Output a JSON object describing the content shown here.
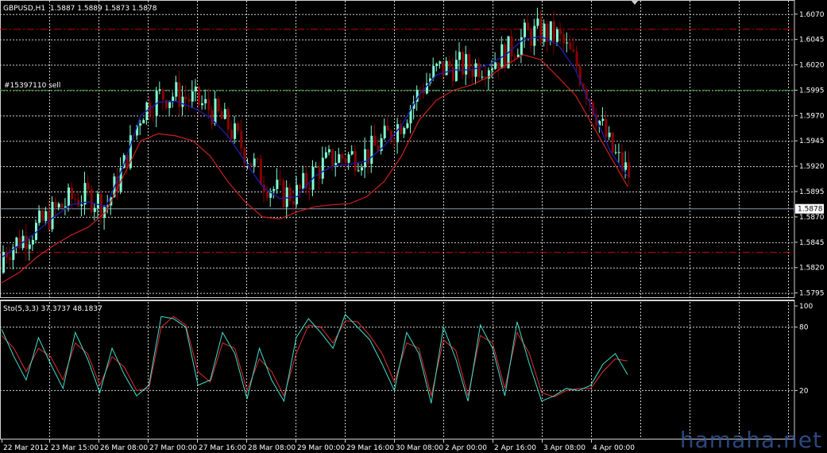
{
  "header": {
    "symbol": "GBPUSD,H1",
    "quote": "1.5887 1.5889 1.5873 1.5878"
  },
  "order_label": "#15397110 sell",
  "indicator_header": "Sto(5,3,3) 37.3737 48.1837",
  "watermark": "hamaha.net",
  "colors": {
    "background": "#000000",
    "bull": "#7fffd4",
    "bear": "#8b0000",
    "ma_fast": "#cc1f1f",
    "ma_slow": "#1c1ca0",
    "stoch_main": "#40e0d0",
    "stoch_signal": "#e03030",
    "level_red": "#cc0000",
    "level_green": "#339933",
    "bid_line": "#8899aa",
    "grid": "#cfcfcf"
  },
  "chart_data": [
    {
      "type": "candlestick",
      "name": "price",
      "ylim": [
        1.579,
        1.608
      ],
      "y_ticks": [
        "1.6070",
        "1.6045",
        "1.6020",
        "1.5995",
        "1.5970",
        "1.5945",
        "1.5920",
        "1.5895",
        "1.5870",
        "1.5845",
        "1.5820",
        "1.5795"
      ],
      "x_ticks": [
        "22 Mar 2012",
        "23 Mar 15:00",
        "26 Mar 08:00",
        "27 Mar 00:00",
        "27 Mar 16:00",
        "28 Mar 08:00",
        "29 Mar 00:00",
        "29 Mar 16:00",
        "30 Mar 08:00",
        "2 Apr 00:00",
        "2 Apr 16:00",
        "3 Apr 08:00",
        "4 Apr 00:00"
      ],
      "current_price": "1.5878",
      "levels": [
        {
          "value": 1.6055,
          "color": "#cc0000"
        },
        {
          "value": 1.5995,
          "color": "#339933"
        },
        {
          "value": 1.5835,
          "color": "#cc0000"
        }
      ],
      "ma_fast_points": [
        1.5805,
        1.5815,
        1.583,
        1.5842,
        1.5852,
        1.586,
        1.5875,
        1.591,
        1.5945,
        1.5952,
        1.595,
        1.5945,
        1.593,
        1.5905,
        1.5885,
        1.587,
        1.5868,
        1.5875,
        1.588,
        1.5882,
        1.5883,
        1.589,
        1.5905,
        1.593,
        1.5965,
        1.5985,
        1.5995,
        1.6,
        1.6008,
        1.602,
        1.603,
        1.6025,
        1.6008,
        1.599,
        1.596,
        1.593,
        1.59
      ],
      "ma_slow_points": [
        1.583,
        1.5842,
        1.5855,
        1.587,
        1.5882,
        1.5885,
        1.588,
        1.592,
        1.597,
        1.5983,
        1.5984,
        1.5978,
        1.5968,
        1.595,
        1.5925,
        1.59,
        1.5888,
        1.589,
        1.591,
        1.592,
        1.5922,
        1.5925,
        1.594,
        1.596,
        1.599,
        1.601,
        1.6015,
        1.6015,
        1.602,
        1.603,
        1.6045,
        1.6048,
        1.604,
        1.6015,
        1.5975,
        1.5935,
        1.591
      ]
    },
    {
      "type": "line",
      "name": "stochastic",
      "ylim": [
        0,
        100
      ],
      "y_ticks": [
        "100",
        "80",
        "20"
      ],
      "levels": [
        80,
        20
      ],
      "series": [
        {
          "values": [
            78,
            52,
            30,
            70,
            45,
            22,
            75,
            50,
            18,
            60,
            35,
            15,
            25,
            90,
            88,
            80,
            25,
            30,
            75,
            55,
            12,
            60,
            30,
            10,
            70,
            88,
            75,
            60,
            92,
            80,
            68,
            45,
            20,
            75,
            55,
            8,
            80,
            50,
            10,
            82,
            60,
            15,
            85,
            45,
            10,
            15,
            22,
            20,
            25,
            45,
            55,
            35
          ]
        },
        {
          "values": [
            72,
            60,
            38,
            60,
            52,
            30,
            65,
            55,
            25,
            52,
            42,
            20,
            22,
            80,
            90,
            82,
            38,
            28,
            65,
            60,
            20,
            50,
            38,
            15,
            55,
            82,
            80,
            65,
            86,
            85,
            72,
            55,
            28,
            65,
            60,
            15,
            68,
            58,
            15,
            72,
            65,
            22,
            75,
            55,
            18,
            14,
            20,
            22,
            22,
            38,
            50,
            48
          ]
        }
      ]
    }
  ]
}
